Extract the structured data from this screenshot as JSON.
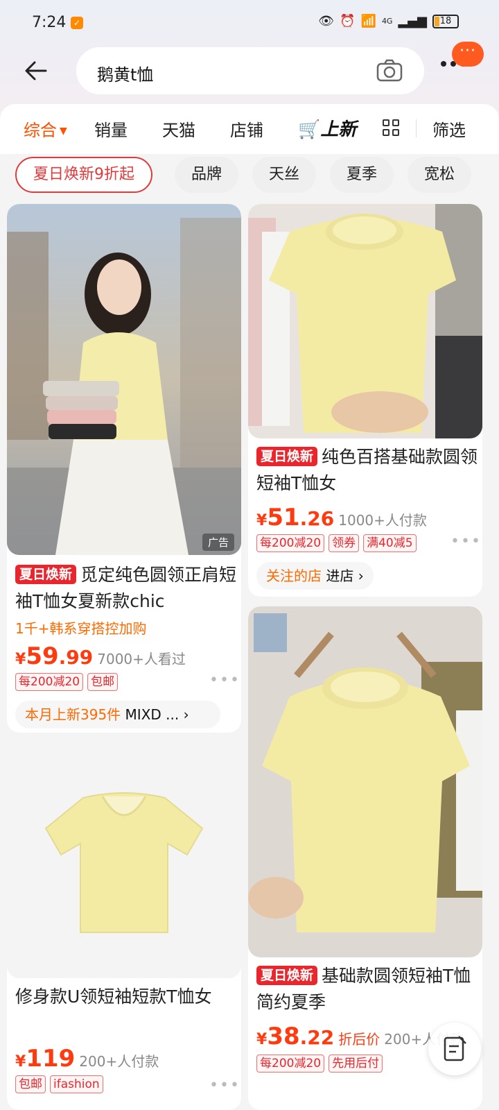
{
  "status_bar": {
    "time": "7:24",
    "network": "4G",
    "battery": "18"
  },
  "search": {
    "query": "鹅黄t恤"
  },
  "filter_tabs": {
    "comprehensive": "综合",
    "sales": "销量",
    "tmall": "天猫",
    "shops": "店铺",
    "new_arrivals": "上新",
    "filter": "筛选"
  },
  "chips": [
    "夏日焕新9折起",
    "品牌",
    "天丝",
    "夏季",
    "宽松"
  ],
  "products": [
    {
      "promo_badge": "夏日焕新",
      "title": "觅定纯色圆领正肩短袖T恤女夏新款chic",
      "subtitle": "1千+韩系穿搭控加购",
      "price_int": "59",
      "price_dec": ".99",
      "sales": "7000+人看过",
      "tags": [
        "每200减20",
        "包邮"
      ],
      "shop_highlight": "本月上新395件",
      "shop_name": "MIXD ...",
      "ad_label": "广告"
    },
    {
      "promo_badge": "夏日焕新",
      "title": "纯色百搭基础款圆领短袖T恤女",
      "price_int": "51",
      "price_dec": ".26",
      "sales": "1000+人付款",
      "tags": [
        "每200减20",
        "领券",
        "满40减5"
      ],
      "shop_highlight": "关注的店",
      "shop_name": "进店"
    },
    {
      "title": "修身款U领短袖短款T恤女",
      "price_int": "119",
      "price_dec": "",
      "sales": "200+人付款",
      "tags": [
        "包邮",
        "ifashion"
      ]
    },
    {
      "promo_badge": "夏日焕新",
      "title": "基础款圆领短袖T恤简约夏季",
      "price_int": "38",
      "price_dec": ".22",
      "price_note": "折后价",
      "sales": "200+人付款",
      "tags": [
        "每200减20",
        "先用后付"
      ]
    }
  ],
  "colors": {
    "accent": "#ff5000",
    "promo_red": "#e8262d",
    "price": "#ff3a0f",
    "shirt_yellow": "#f3eba4"
  }
}
